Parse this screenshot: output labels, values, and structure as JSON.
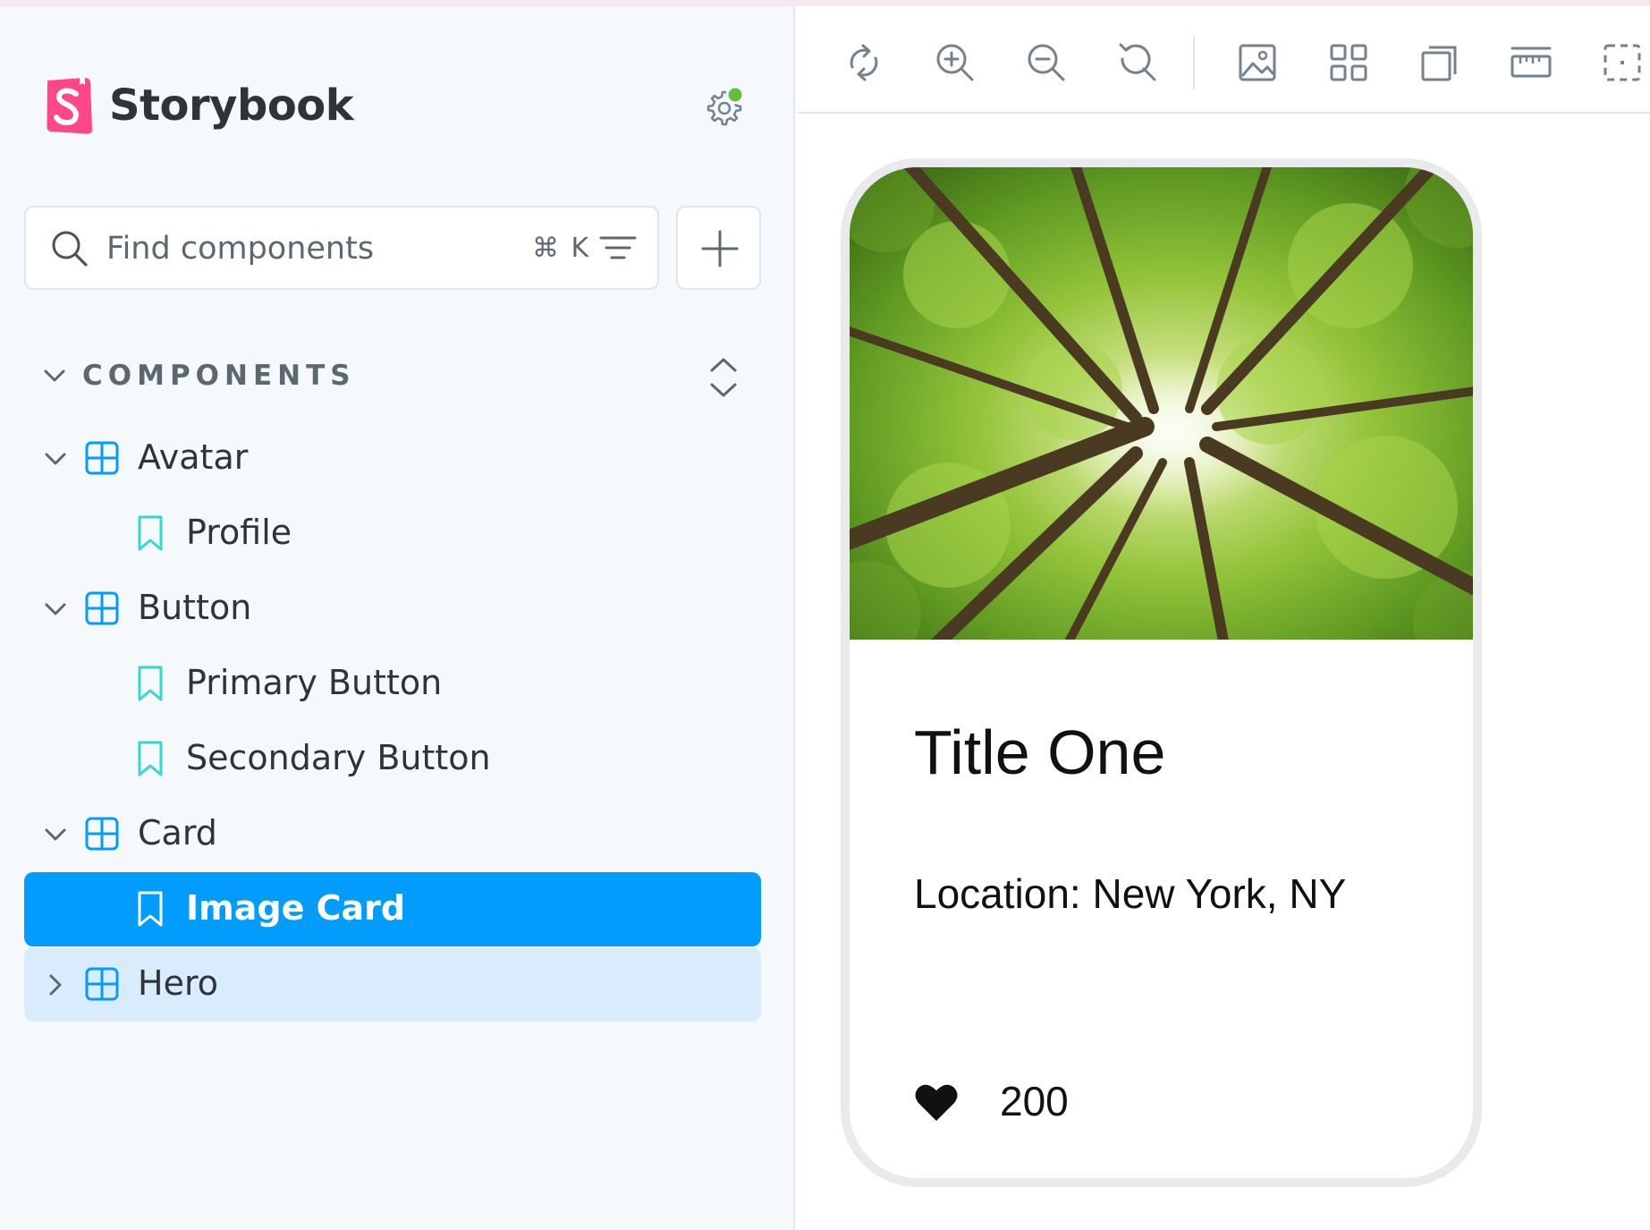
{
  "app": {
    "name": "Storybook"
  },
  "search": {
    "placeholder": "Find components",
    "shortcut": "⌘ K"
  },
  "sidebar": {
    "section_title": "COMPONENTS",
    "items": [
      {
        "label": "Avatar",
        "kind": "component",
        "expanded": true
      },
      {
        "label": "Profile",
        "kind": "story"
      },
      {
        "label": "Button",
        "kind": "component",
        "expanded": true
      },
      {
        "label": "Primary Button",
        "kind": "story"
      },
      {
        "label": "Secondary Button",
        "kind": "story"
      },
      {
        "label": "Card",
        "kind": "component",
        "expanded": true
      },
      {
        "label": "Image Card",
        "kind": "story",
        "selected": true
      },
      {
        "label": "Hero",
        "kind": "component",
        "expanded": false,
        "hovered": true
      }
    ]
  },
  "toolbar": {
    "tools": [
      "remount-icon",
      "zoom-in-icon",
      "zoom-out-icon",
      "zoom-reset-icon",
      "background-icon",
      "grid-icon",
      "viewport-icon",
      "measure-icon",
      "outline-icon"
    ]
  },
  "card": {
    "title": "Title One",
    "location": "Location: New York, NY",
    "likes": "200"
  },
  "colors": {
    "accent": "#029cfd",
    "hover": "#d9ecfd",
    "brand": "#ff4785",
    "status_ok": "#66bf3c",
    "story_icon": "#37d5d3",
    "component_icon": "#029cfd"
  }
}
